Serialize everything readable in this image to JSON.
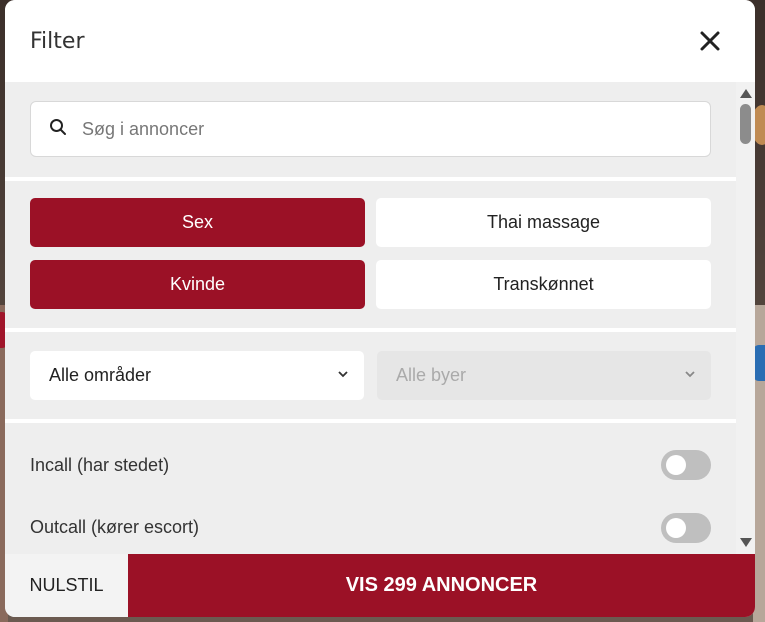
{
  "modal": {
    "title": "Filter",
    "close_icon": "close-icon"
  },
  "search": {
    "placeholder": "Søg i annoncer",
    "value": "",
    "icon": "search-icon"
  },
  "categories": [
    {
      "label": "Sex",
      "active": true
    },
    {
      "label": "Thai massage",
      "active": false
    },
    {
      "label": "Kvinde",
      "active": true
    },
    {
      "label": "Transkønnet",
      "active": false
    }
  ],
  "selects": {
    "region": {
      "value": "Alle områder",
      "enabled": true
    },
    "city": {
      "value": "Alle byer",
      "enabled": false
    }
  },
  "switches": [
    {
      "label": "Incall (har stedet)",
      "on": false
    },
    {
      "label": "Outcall (kører escort)",
      "on": false
    }
  ],
  "footer": {
    "reset_label": "NULSTIL",
    "show_label": "VIS 299 ANNONCER"
  },
  "colors": {
    "accent": "#9b1126",
    "panel": "#eeeeee"
  }
}
